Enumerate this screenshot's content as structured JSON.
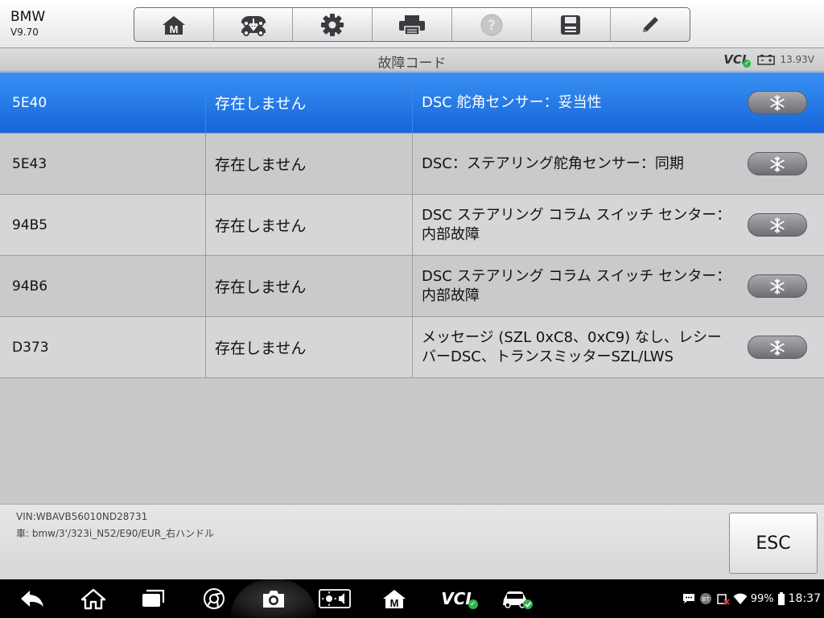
{
  "app": {
    "brand": "BMW",
    "version": "V9.70"
  },
  "toolbar": {
    "buttons": [
      {
        "icon": "home-m-icon"
      },
      {
        "icon": "vehicle-swap-icon"
      },
      {
        "icon": "gear-icon"
      },
      {
        "icon": "printer-icon"
      },
      {
        "icon": "help-icon"
      },
      {
        "icon": "save-icon"
      },
      {
        "icon": "pencil-icon"
      }
    ]
  },
  "title_bar": {
    "title": "故障コード",
    "vci_label": "VCI",
    "voltage": "13.93V"
  },
  "codes": [
    {
      "code": "5E40",
      "status": "存在しません",
      "description": "DSC 舵角センサー：妥当性",
      "selected": true
    },
    {
      "code": "5E43",
      "status": "存在しません",
      "description": "DSC：ステアリング舵角センサー：同期",
      "selected": false
    },
    {
      "code": "94B5",
      "status": "存在しません",
      "description": "DSC ステアリング コラム スイッチ センター：内部故障",
      "selected": false
    },
    {
      "code": "94B6",
      "status": "存在しません",
      "description": "DSC ステアリング コラム スイッチ センター：内部故障",
      "selected": false
    },
    {
      "code": "D373",
      "status": "存在しません",
      "description": "メッセージ (SZL 0xC8、0xC9) なし、レシーバーDSC、トランスミッターSZL/LWS",
      "selected": false
    }
  ],
  "vehicle": {
    "vin": "VIN:WBAVB56010ND28731",
    "car": "車: bmw/3'/323i_N52/E90/EUR_右ハンドル"
  },
  "esc_label": "ESC",
  "status_bar": {
    "battery": "99%",
    "time": "18:37",
    "vci_label": "VCI"
  },
  "colors": {
    "selected_row": "#1f74e6",
    "nav_bg": "#000000",
    "ok_green": "#2db34a"
  }
}
